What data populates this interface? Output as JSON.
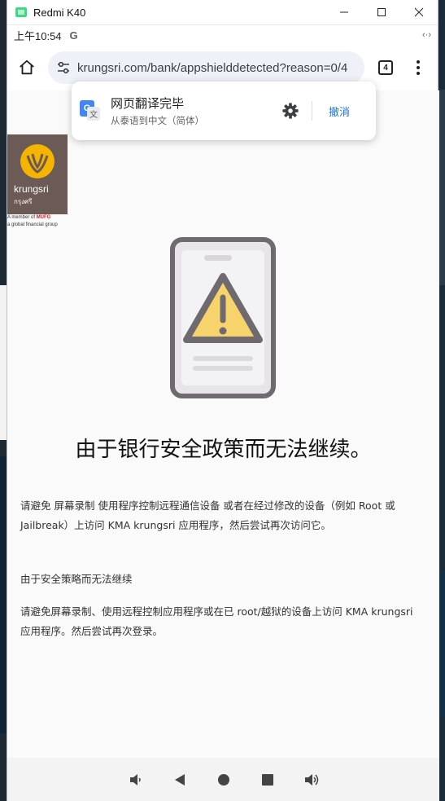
{
  "window": {
    "title": "Redmi K40"
  },
  "statusbar": {
    "time": "上午10:54",
    "g_icon": "G",
    "right": "‹·›"
  },
  "browser": {
    "url": "krungsri.com/bank/appshielddetected?reason=0/4",
    "tab_count": "4"
  },
  "translate_popup": {
    "title": "网页翻译完毕",
    "subtitle": "从泰语到中文（简体）",
    "undo_label": "撤消"
  },
  "logo": {
    "name": "krungsri",
    "thai": "กรุงศรี",
    "member_text": "A member of",
    "mufg": "MUFG",
    "group_text": "a global financial group"
  },
  "main": {
    "headline": "由于银行安全政策而无法继续。",
    "para1": "请避免 屏幕录制 使用程序控制远程通信设备 或者在经过修改的设备（例如 Root 或 Jailbreak）上访问 KMA krungsri 应用程序，然后尝试再次访问它。",
    "para2": "由于安全策略而无法继续",
    "para3": "请避免屏幕录制、使用远程控制应用程序或在已 root/越狱的设备上访问 KMA krungsri 应用程序。然后尝试再次登录。"
  },
  "colors": {
    "accent": "#1a73e8",
    "warning": "#f6d36b",
    "phone_frame": "#6e6a6f"
  }
}
